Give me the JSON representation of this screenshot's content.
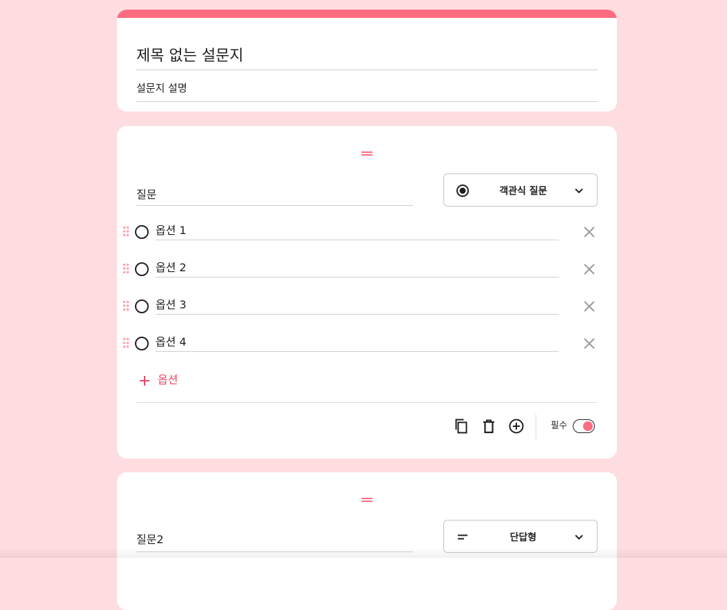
{
  "colors": {
    "background": "#fedde0",
    "accent": "#ff6b81",
    "accent_text": "#e8495f"
  },
  "form": {
    "title": "제목 없는 설문지",
    "description": "설문지 설명"
  },
  "question1": {
    "title": "질문",
    "type": {
      "icon": "radio-checked-icon",
      "label": "객관식 질문"
    },
    "options": [
      {
        "label": "옵션 1"
      },
      {
        "label": "옵션 2"
      },
      {
        "label": "옵션 3"
      },
      {
        "label": "옵션 4"
      }
    ],
    "add_option_label": "옵션",
    "required_label": "필수",
    "required": true
  },
  "question2": {
    "title": "질문2",
    "type": {
      "icon": "short-text-icon",
      "label": "단답형"
    }
  }
}
